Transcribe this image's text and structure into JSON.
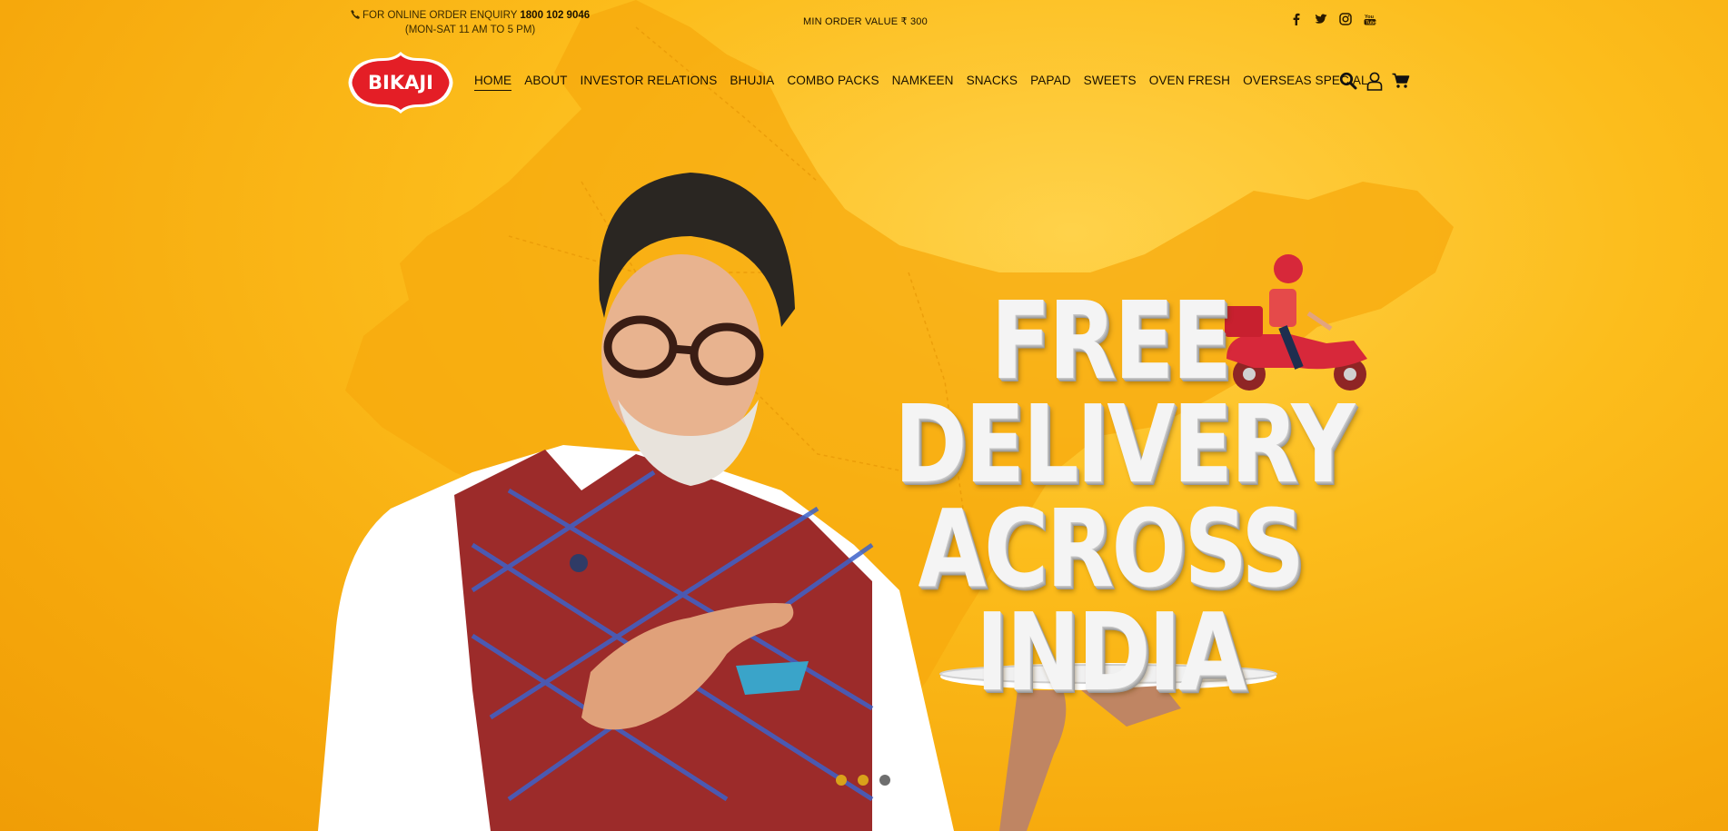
{
  "topbar": {
    "enquiry_label": "FOR ONLINE ORDER ENQUIRY",
    "phone": "1800 102 9046",
    "hours": "(MON-SAT 11 AM TO 5 PM)",
    "min_order": "MIN ORDER VALUE ₹ 300",
    "social_icons": [
      "facebook-icon",
      "twitter-icon",
      "instagram-icon",
      "youtube-icon"
    ]
  },
  "brand": {
    "logo_text": "BIKAJI"
  },
  "nav": {
    "items": [
      {
        "label": "HOME",
        "active": true
      },
      {
        "label": "ABOUT"
      },
      {
        "label": "INVESTOR RELATIONS"
      },
      {
        "label": "BHUJIA"
      },
      {
        "label": "COMBO PACKS"
      },
      {
        "label": "NAMKEEN"
      },
      {
        "label": "SNACKS"
      },
      {
        "label": "PAPAD"
      },
      {
        "label": "SWEETS"
      },
      {
        "label": "OVEN FRESH"
      },
      {
        "label": "OVERSEAS SPECIAL"
      }
    ],
    "icons": [
      "search-icon",
      "user-icon",
      "cart-icon"
    ]
  },
  "hero": {
    "line1": "FREE",
    "line2": "DELIVERY",
    "line3": "ACROSS",
    "line4": "INDIA",
    "slides": 3,
    "active_slide": 3
  },
  "colors": {
    "background": "#fcbd1c",
    "brand_red": "#e41e26",
    "text_dark": "#1a1100"
  }
}
